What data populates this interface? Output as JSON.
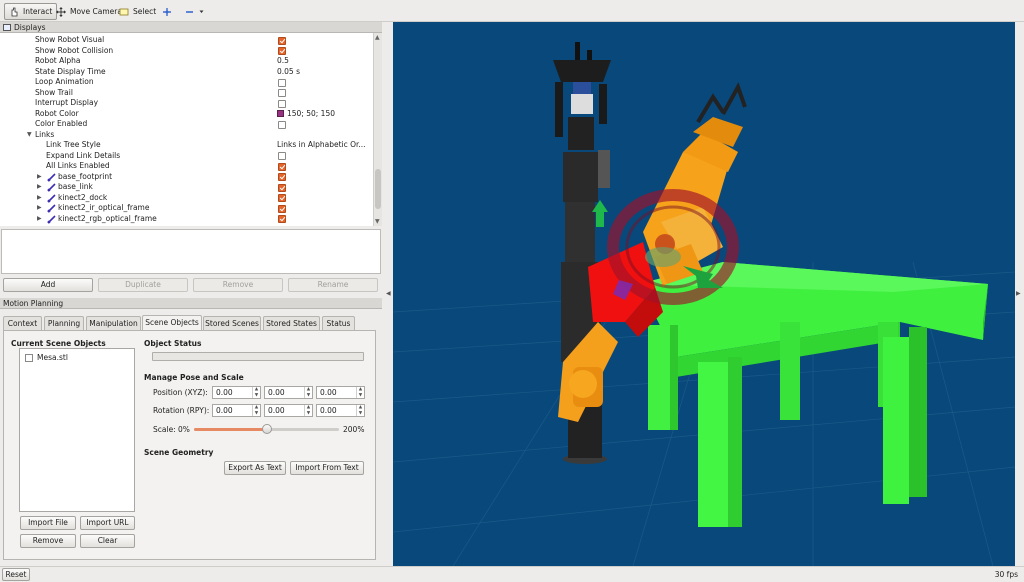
{
  "toolbar": {
    "interact": "Interact",
    "move_camera": "Move Camera",
    "select": "Select"
  },
  "displays": {
    "title": "Displays",
    "rows": [
      {
        "name": "Show Robot Visual",
        "checked": true
      },
      {
        "name": "Show Robot Collision",
        "checked": true
      },
      {
        "name": "Robot Alpha",
        "value": "0.5"
      },
      {
        "name": "State Display Time",
        "value": "0.05 s"
      },
      {
        "name": "Loop Animation",
        "checked": false
      },
      {
        "name": "Show Trail",
        "checked": false
      },
      {
        "name": "Interrupt Display",
        "checked": false
      },
      {
        "name": "Robot Color",
        "value": "150; 50; 150",
        "color": "#96327f"
      },
      {
        "name": "Color Enabled",
        "checked": false
      },
      {
        "name": "Links"
      },
      {
        "name": "Link Tree Style",
        "value": "Links in Alphabetic Or..."
      },
      {
        "name": "Expand Link Details",
        "checked": false
      },
      {
        "name": "All Links Enabled",
        "checked": true
      },
      {
        "name": "base_footprint",
        "checked": true
      },
      {
        "name": "base_link",
        "checked": true
      },
      {
        "name": "kinect2_dock",
        "checked": true
      },
      {
        "name": "kinect2_ir_optical_frame",
        "checked": true
      },
      {
        "name": "kinect2_rgb_optical_frame",
        "checked": true
      }
    ],
    "buttons": {
      "add": "Add",
      "duplicate": "Duplicate",
      "remove": "Remove",
      "rename": "Rename"
    }
  },
  "motion_planning": {
    "title": "Motion Planning",
    "tabs": [
      "Context",
      "Planning",
      "Manipulation",
      "Scene Objects",
      "Stored Scenes",
      "Stored States",
      "Status"
    ],
    "selected_tab": "Scene Objects",
    "current_scene_objects": "Current Scene Objects",
    "objects": [
      "Mesa.stl"
    ],
    "object_status": "Object Status",
    "manage_pose": "Manage Pose and Scale",
    "position_label": "Position (XYZ):",
    "rotation_label": "Rotation (RPY):",
    "position": [
      "0.00",
      "0.00",
      "0.00"
    ],
    "rotation": [
      "0.00",
      "0.00",
      "0.00"
    ],
    "scale_label": "Scale:",
    "scale_min": "0%",
    "scale_max": "200%",
    "scale_value": 0.5,
    "scene_geometry": "Scene Geometry",
    "export_text": "Export As Text",
    "import_text": "Import From Text",
    "import_file": "Import File",
    "import_url": "Import URL",
    "remove": "Remove",
    "clear": "Clear"
  },
  "status": {
    "reset": "Reset",
    "fps": "30 fps"
  },
  "colors": {
    "viewport_bg": "#08487a",
    "table": "#39f23a",
    "robot_orange": "#f7a21b",
    "robot_dark": "#2b2b2b",
    "checkbox_on": "#e3652c"
  }
}
